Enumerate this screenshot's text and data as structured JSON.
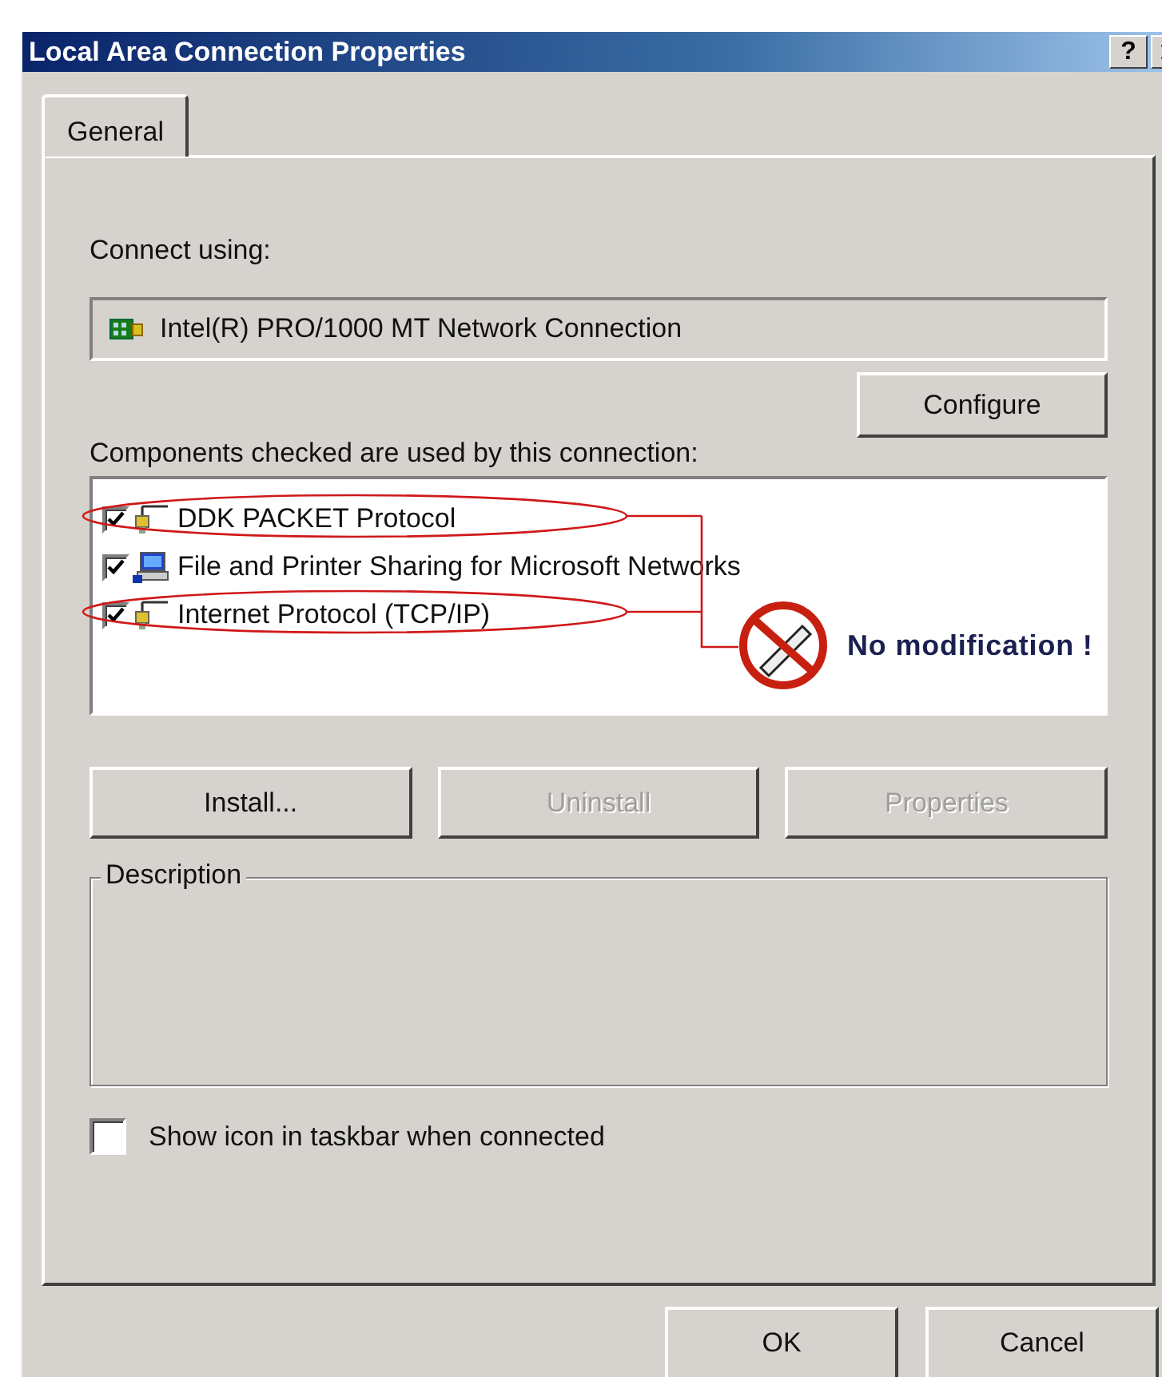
{
  "window": {
    "title": "Local Area Connection Properties",
    "help_button": "?"
  },
  "tabs": [
    {
      "label": "General",
      "selected": true
    }
  ],
  "connect_using": {
    "label": "Connect using:",
    "adapter": "Intel(R) PRO/1000 MT Network Connection"
  },
  "configure_button": "Configure",
  "components": {
    "label": "Components checked are used by this connection:",
    "items": [
      {
        "kind": "protocol",
        "label": "DDK PACKET Protocol",
        "checked": true,
        "circled": true
      },
      {
        "kind": "service",
        "label": "File and Printer Sharing for Microsoft Networks",
        "checked": true,
        "circled": false
      },
      {
        "kind": "protocol",
        "label": "Internet Protocol (TCP/IP)",
        "checked": true,
        "circled": true
      }
    ]
  },
  "annotation": {
    "text": "No modification !"
  },
  "component_buttons": [
    {
      "label": "Install...",
      "disabled": false
    },
    {
      "label": "Uninstall",
      "disabled": true
    },
    {
      "label": "Properties",
      "disabled": true
    }
  ],
  "description": {
    "label": "Description"
  },
  "taskbar_option": {
    "label": "Show icon in taskbar when connected",
    "checked": false
  },
  "dialog_buttons": [
    {
      "label": "OK"
    },
    {
      "label": "Cancel"
    }
  ]
}
